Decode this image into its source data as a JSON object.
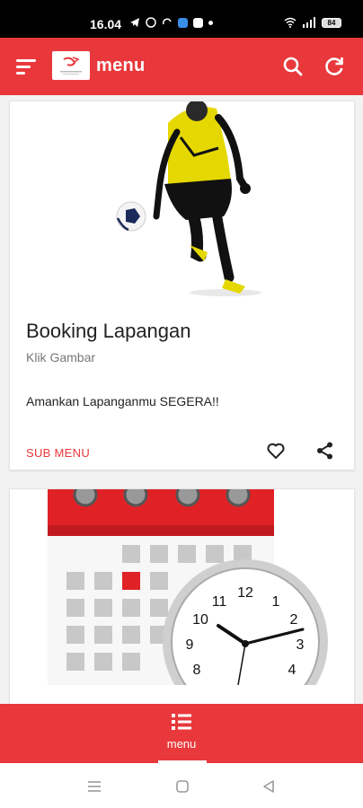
{
  "status_bar": {
    "time": "16.04",
    "battery": "84"
  },
  "app_bar": {
    "title": "menu"
  },
  "cards": [
    {
      "title": "Booking Lapangan",
      "subtitle": "Klik Gambar",
      "description": "Amankan Lapanganmu SEGERA!!",
      "action": "SUB MENU"
    }
  ],
  "calendar": {
    "clock_numbers": [
      "12",
      "1",
      "2",
      "3",
      "4",
      "8",
      "9",
      "10",
      "11"
    ]
  },
  "bottom_nav": {
    "label": "menu"
  },
  "colors": {
    "primary": "#e8383b",
    "surface": "#ffffff",
    "background": "#f2f2f2"
  }
}
